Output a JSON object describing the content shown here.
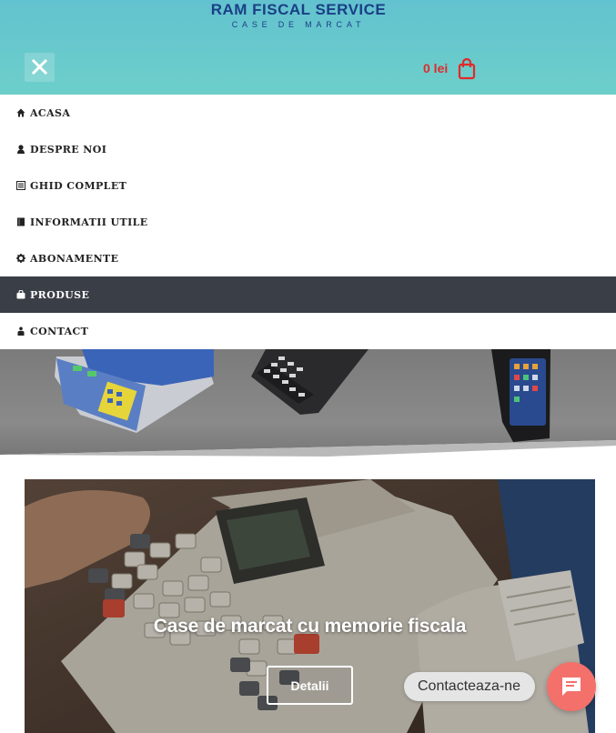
{
  "header": {
    "logo_title": "RAM FISCAL SERVICE",
    "logo_subtitle": "CASE DE MARCAT",
    "cart_total": "0 lei",
    "colors": {
      "gradient_top": "#63c2cf",
      "gradient_bottom": "#6dcfca",
      "logo": "#1a3f86",
      "cart": "#e02a2a"
    }
  },
  "menu": {
    "active_background": "#3a3e46",
    "items": [
      {
        "label": "ACASA",
        "icon": "home-icon"
      },
      {
        "label": "DESPRE NOI",
        "icon": "user-icon"
      },
      {
        "label": "GHID COMPLET",
        "icon": "list-icon"
      },
      {
        "label": "INFORMATII UTILE",
        "icon": "book-icon"
      },
      {
        "label": "ABONAMENTE",
        "icon": "gear-icon"
      },
      {
        "label": "PRODUSE",
        "icon": "shopping-bag-icon",
        "active": true
      },
      {
        "label": "CONTACT",
        "icon": "contact-icon"
      }
    ]
  },
  "hero": {
    "title": "Case de marcat cu memorie fiscala",
    "button_label": "Detalii"
  },
  "chat": {
    "label": "Contacteaza-ne",
    "color": "#f4706b"
  }
}
